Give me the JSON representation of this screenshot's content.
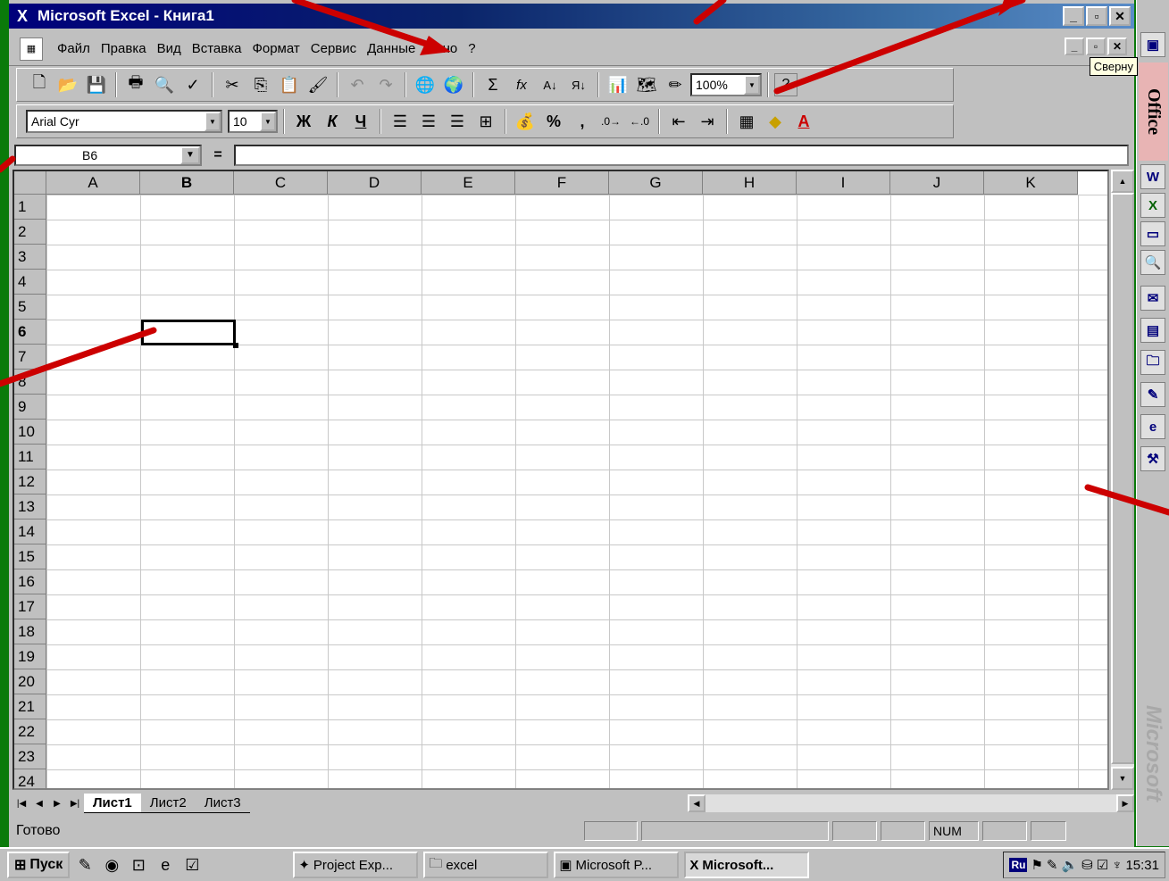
{
  "window": {
    "title": "Microsoft Excel - Книга1",
    "min": "_",
    "max": "▫",
    "close": "✕"
  },
  "menu": {
    "items": [
      "Файл",
      "Правка",
      "Вид",
      "Вставка",
      "Формат",
      "Сервис",
      "Данные",
      "Окно",
      "?"
    ],
    "tooltip": "Сверну"
  },
  "toolbar": {
    "zoom": "100%",
    "font": "Arial Cyr",
    "size": "10",
    "bold": "Ж",
    "italic": "К",
    "underline": "Ч",
    "percent": "%",
    "comma": ",",
    "increase_decimal": "⁰⁰→",
    "decrease_decimal": "←⁰",
    "sum": "Σ",
    "function": "fx"
  },
  "formula_bar": {
    "name_box": "B6",
    "equals": "="
  },
  "grid": {
    "columns": [
      "A",
      "B",
      "C",
      "D",
      "E",
      "F",
      "G",
      "H",
      "I",
      "J",
      "K"
    ],
    "rows": [
      "1",
      "2",
      "3",
      "4",
      "5",
      "6",
      "7",
      "8",
      "9",
      "10",
      "11",
      "12",
      "13",
      "14",
      "15",
      "16",
      "17",
      "18",
      "19",
      "20",
      "21",
      "22",
      "23",
      "24"
    ],
    "active_cell": "B6",
    "active_column": "B",
    "active_row": "6"
  },
  "sheets": [
    "Лист1",
    "Лист2",
    "Лист3"
  ],
  "active_sheet": "Лист1",
  "status": {
    "text": "Готово",
    "num": "NUM"
  },
  "office_bar": {
    "label": "Office",
    "watermark": "Microsoft"
  },
  "taskbar": {
    "start": "Пуск",
    "tasks": [
      "Project Exp...",
      "excel",
      "Microsoft P...",
      "Microsoft..."
    ],
    "active_task": "Microsoft...",
    "lang": "Ru",
    "clock": "15:31"
  },
  "colors": {
    "desktop": "#0a7a0a",
    "title": "#00007b",
    "annotation": "#cc0000"
  }
}
